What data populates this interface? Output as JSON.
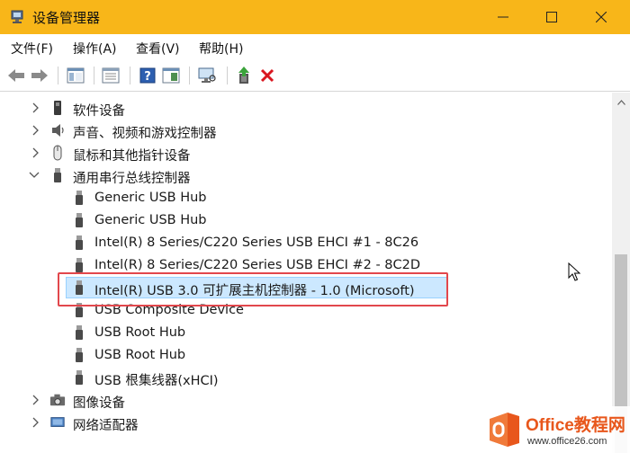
{
  "window": {
    "title": "设备管理器",
    "accent": "#f8b619"
  },
  "menu": [
    "文件(F)",
    "操作(A)",
    "查看(V)",
    "帮助(H)"
  ],
  "tree": {
    "rows": [
      {
        "label": "软件设备",
        "chevron": "collapsed",
        "icon": "software-device-icon"
      },
      {
        "label": "声音、视频和游戏控制器",
        "chevron": "collapsed",
        "icon": "speaker-icon"
      },
      {
        "label": "鼠标和其他指针设备",
        "chevron": "collapsed",
        "icon": "mouse-icon"
      },
      {
        "label": "通用串行总线控制器",
        "chevron": "expanded",
        "icon": "usb-icon"
      },
      {
        "label": "Generic USB Hub",
        "icon": "usb-icon"
      },
      {
        "label": "Generic USB Hub",
        "icon": "usb-icon"
      },
      {
        "label": "Intel(R) 8 Series/C220 Series USB EHCI #1 - 8C26",
        "icon": "usb-icon"
      },
      {
        "label": "Intel(R) 8 Series/C220 Series USB EHCI #2 - 8C2D",
        "icon": "usb-icon"
      },
      {
        "label": "Intel(R) USB 3.0 可扩展主机控制器 - 1.0 (Microsoft)",
        "icon": "usb-icon",
        "selected": true
      },
      {
        "label": "USB Composite Device",
        "icon": "usb-icon"
      },
      {
        "label": "USB Root Hub",
        "icon": "usb-icon"
      },
      {
        "label": "USB Root Hub",
        "icon": "usb-icon"
      },
      {
        "label": "USB 根集线器(xHCI)",
        "icon": "usb-icon"
      },
      {
        "label": "图像设备",
        "chevron": "collapsed",
        "icon": "camera-icon"
      },
      {
        "label": "网络适配器",
        "chevron": "collapsed",
        "icon": "network-adapter-icon"
      }
    ]
  },
  "watermark": {
    "brand": "Office教程网",
    "url": "www.office26.com"
  }
}
